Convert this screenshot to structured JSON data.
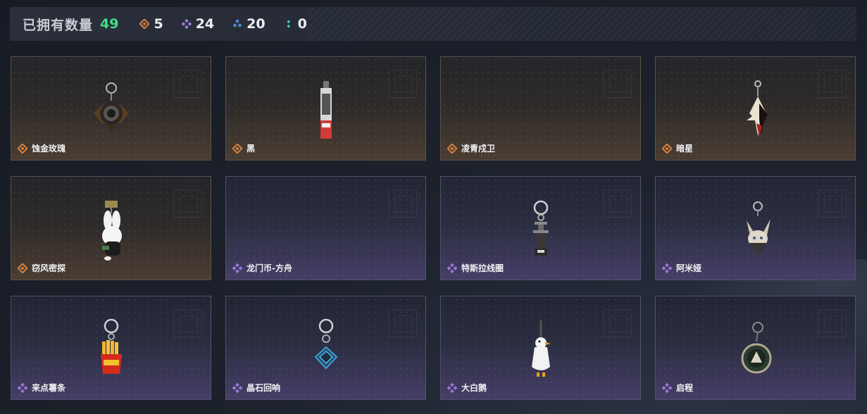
{
  "header": {
    "owned_label": "已拥有数量",
    "owned_count": "49",
    "stats": [
      {
        "icon": "orange-diamond-icon",
        "color": "#d9823f",
        "value": "5"
      },
      {
        "icon": "purple-diamond-icon",
        "color": "#9a7ad8",
        "value": "24"
      },
      {
        "icon": "blue-diamond-icon",
        "color": "#4f8fd8",
        "value": "20"
      },
      {
        "icon": "teal-dots-icon",
        "color": "#3ac7b0",
        "value": "0"
      }
    ]
  },
  "colors": {
    "orange": "#d9823f",
    "purple": "#9a7ad8",
    "owned_count": "#3de08a"
  },
  "items": [
    {
      "name": "蚀金玫瑰",
      "rarity": "orange",
      "art": "rose-keychain-icon"
    },
    {
      "name": "黑",
      "rarity": "orange",
      "art": "tag-keychain-icon"
    },
    {
      "name": "凌青戍卫",
      "rarity": "orange",
      "art": "empty"
    },
    {
      "name": "暗星",
      "rarity": "orange",
      "art": "dark-star-keychain-icon"
    },
    {
      "name": "窃风密探",
      "rarity": "orange",
      "art": "rabbit-keychain-icon"
    },
    {
      "name": "龙门币-方舟",
      "rarity": "purple",
      "art": "empty"
    },
    {
      "name": "特斯拉线圈",
      "rarity": "purple",
      "art": "tesla-coil-keychain-icon"
    },
    {
      "name": "阿米娅",
      "rarity": "purple",
      "art": "amiya-keychain-icon"
    },
    {
      "name": "来点薯条",
      "rarity": "purple",
      "art": "fries-keychain-icon"
    },
    {
      "name": "晶石回响",
      "rarity": "purple",
      "art": "crystal-keychain-icon"
    },
    {
      "name": "大白鹅",
      "rarity": "purple",
      "art": "goose-keychain-icon"
    },
    {
      "name": "启程",
      "rarity": "purple",
      "art": "medallion-keychain-icon"
    }
  ]
}
